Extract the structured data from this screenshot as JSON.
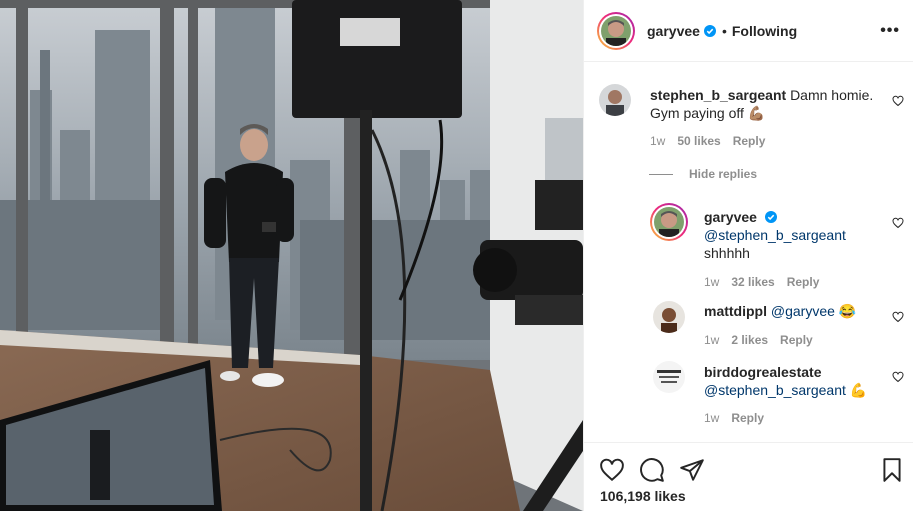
{
  "post": {
    "author": "garyvee",
    "follow_dot": "•",
    "follow_status": "Following",
    "more_icon": "more-icon",
    "likes_text": "106,198 likes"
  },
  "comments": [
    {
      "user": "stephen_b_sargeant",
      "text": "Damn homie. Gym paying off 💪🏽",
      "age": "1w",
      "likes": "50 likes",
      "reply": "Reply"
    }
  ],
  "hide_replies": "Hide replies",
  "replies": [
    {
      "user": "garyvee",
      "mention": "@stephen_b_sargeant",
      "text": "shhhhh",
      "age": "1w",
      "likes": "32 likes",
      "reply": "Reply"
    },
    {
      "user": "mattdippl",
      "mention": "@garyvee",
      "text": "😂",
      "age": "1w",
      "likes": "2 likes",
      "reply": "Reply"
    },
    {
      "user": "birddogrealestate",
      "mention": "@stephen_b_sargeant",
      "text": "💪",
      "age": "1w",
      "reply": "Reply"
    }
  ],
  "colors": {
    "accent_blue": "#0095f6",
    "mention": "#00376b",
    "secondary_text": "#8e8e8e",
    "story_ring": [
      "#f9ce34",
      "#ee2a7b",
      "#9b27b0"
    ]
  },
  "icons": [
    "heart-icon",
    "comment-icon",
    "share-icon",
    "bookmark-icon",
    "verified-icon"
  ]
}
